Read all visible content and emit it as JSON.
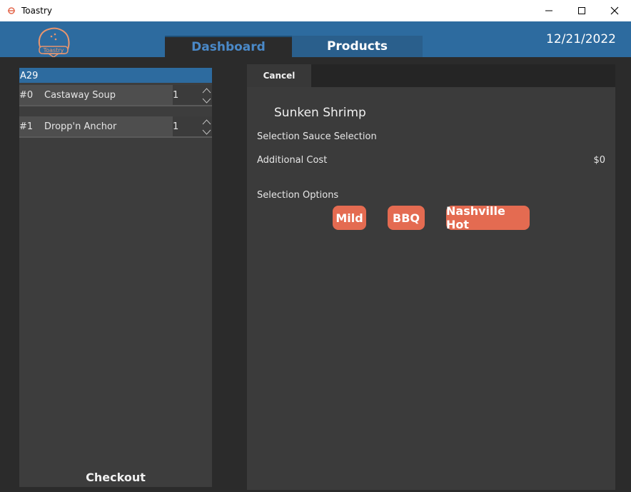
{
  "window": {
    "title": "Toastry",
    "icon": "toastry-app-icon",
    "controls": [
      "minimize",
      "maximize",
      "close"
    ]
  },
  "header": {
    "logo_text": "Toastry",
    "date": "12/21/2022",
    "tabs": [
      {
        "label": "Dashboard",
        "active": true
      },
      {
        "label": "Products",
        "active": false
      }
    ],
    "colors": {
      "header_bg": "#2d6b9f",
      "active_tab_text": "#4a89c8"
    }
  },
  "order": {
    "id": "A29",
    "items": [
      {
        "index": "#0",
        "name": "Castaway Soup",
        "qty": "1"
      },
      {
        "index": "#1",
        "name": "Dropp'n Anchor",
        "qty": "1"
      }
    ],
    "checkout_label": "Checkout"
  },
  "detail": {
    "cancel_label": "Cancel",
    "product_name": "Sunken Shrimp",
    "selection_label": "Selection Sauce Selection",
    "additional_cost_label": "Additional Cost",
    "additional_cost_value": "$0",
    "options_label": "Selection Options",
    "options": [
      "Mild",
      "BBQ",
      "Nashville Hot"
    ],
    "option_color": "#e46b51"
  }
}
